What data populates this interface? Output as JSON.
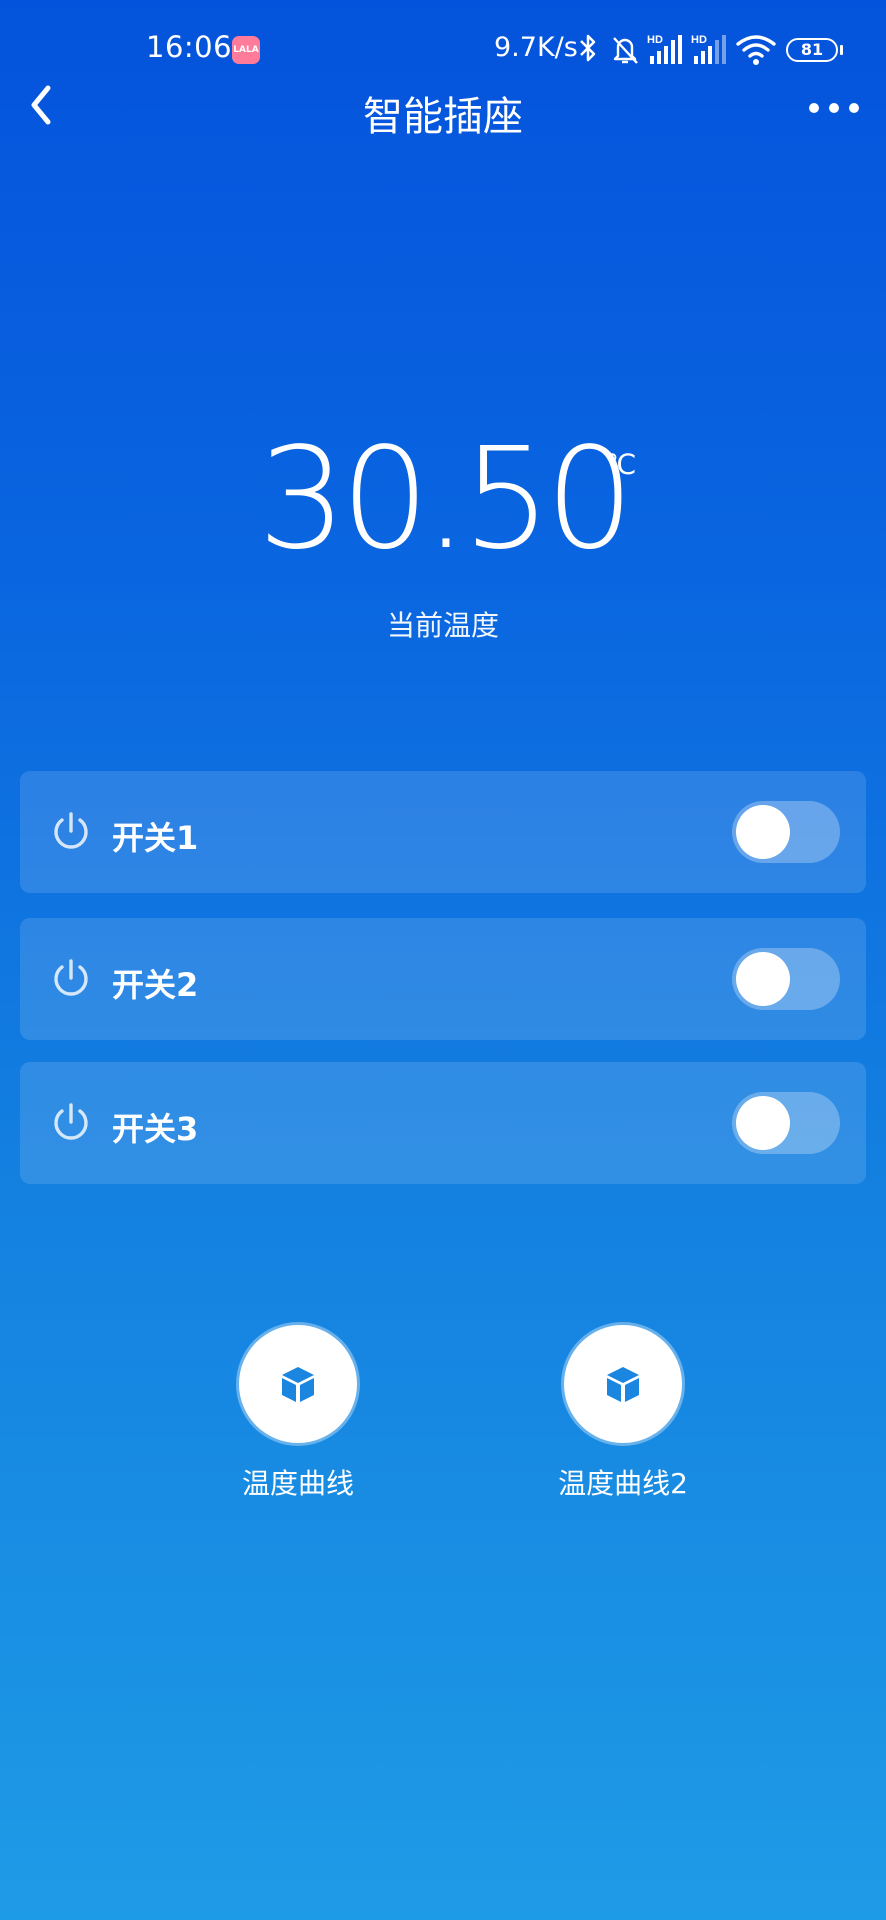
{
  "status_bar": {
    "time": "16:06",
    "app_icon_text": "LALA",
    "net_speed": "9.7K/s",
    "signal_label_1": "HD",
    "signal_label_2": "HD",
    "battery": "81"
  },
  "header": {
    "title": "智能插座"
  },
  "temperature": {
    "value": "30.50",
    "unit": "℃",
    "label": "当前温度"
  },
  "switches": [
    {
      "label": "开关1",
      "on": false
    },
    {
      "label": "开关2",
      "on": false
    },
    {
      "label": "开关3",
      "on": false
    }
  ],
  "actions": [
    {
      "label": "温度曲线",
      "icon": "cube-icon"
    },
    {
      "label": "温度曲线2",
      "icon": "cube-icon"
    }
  ],
  "colors": {
    "gradient_top": "#0453dc",
    "gradient_bottom": "#1e9be6",
    "icon_blue": "#1a86e0"
  }
}
